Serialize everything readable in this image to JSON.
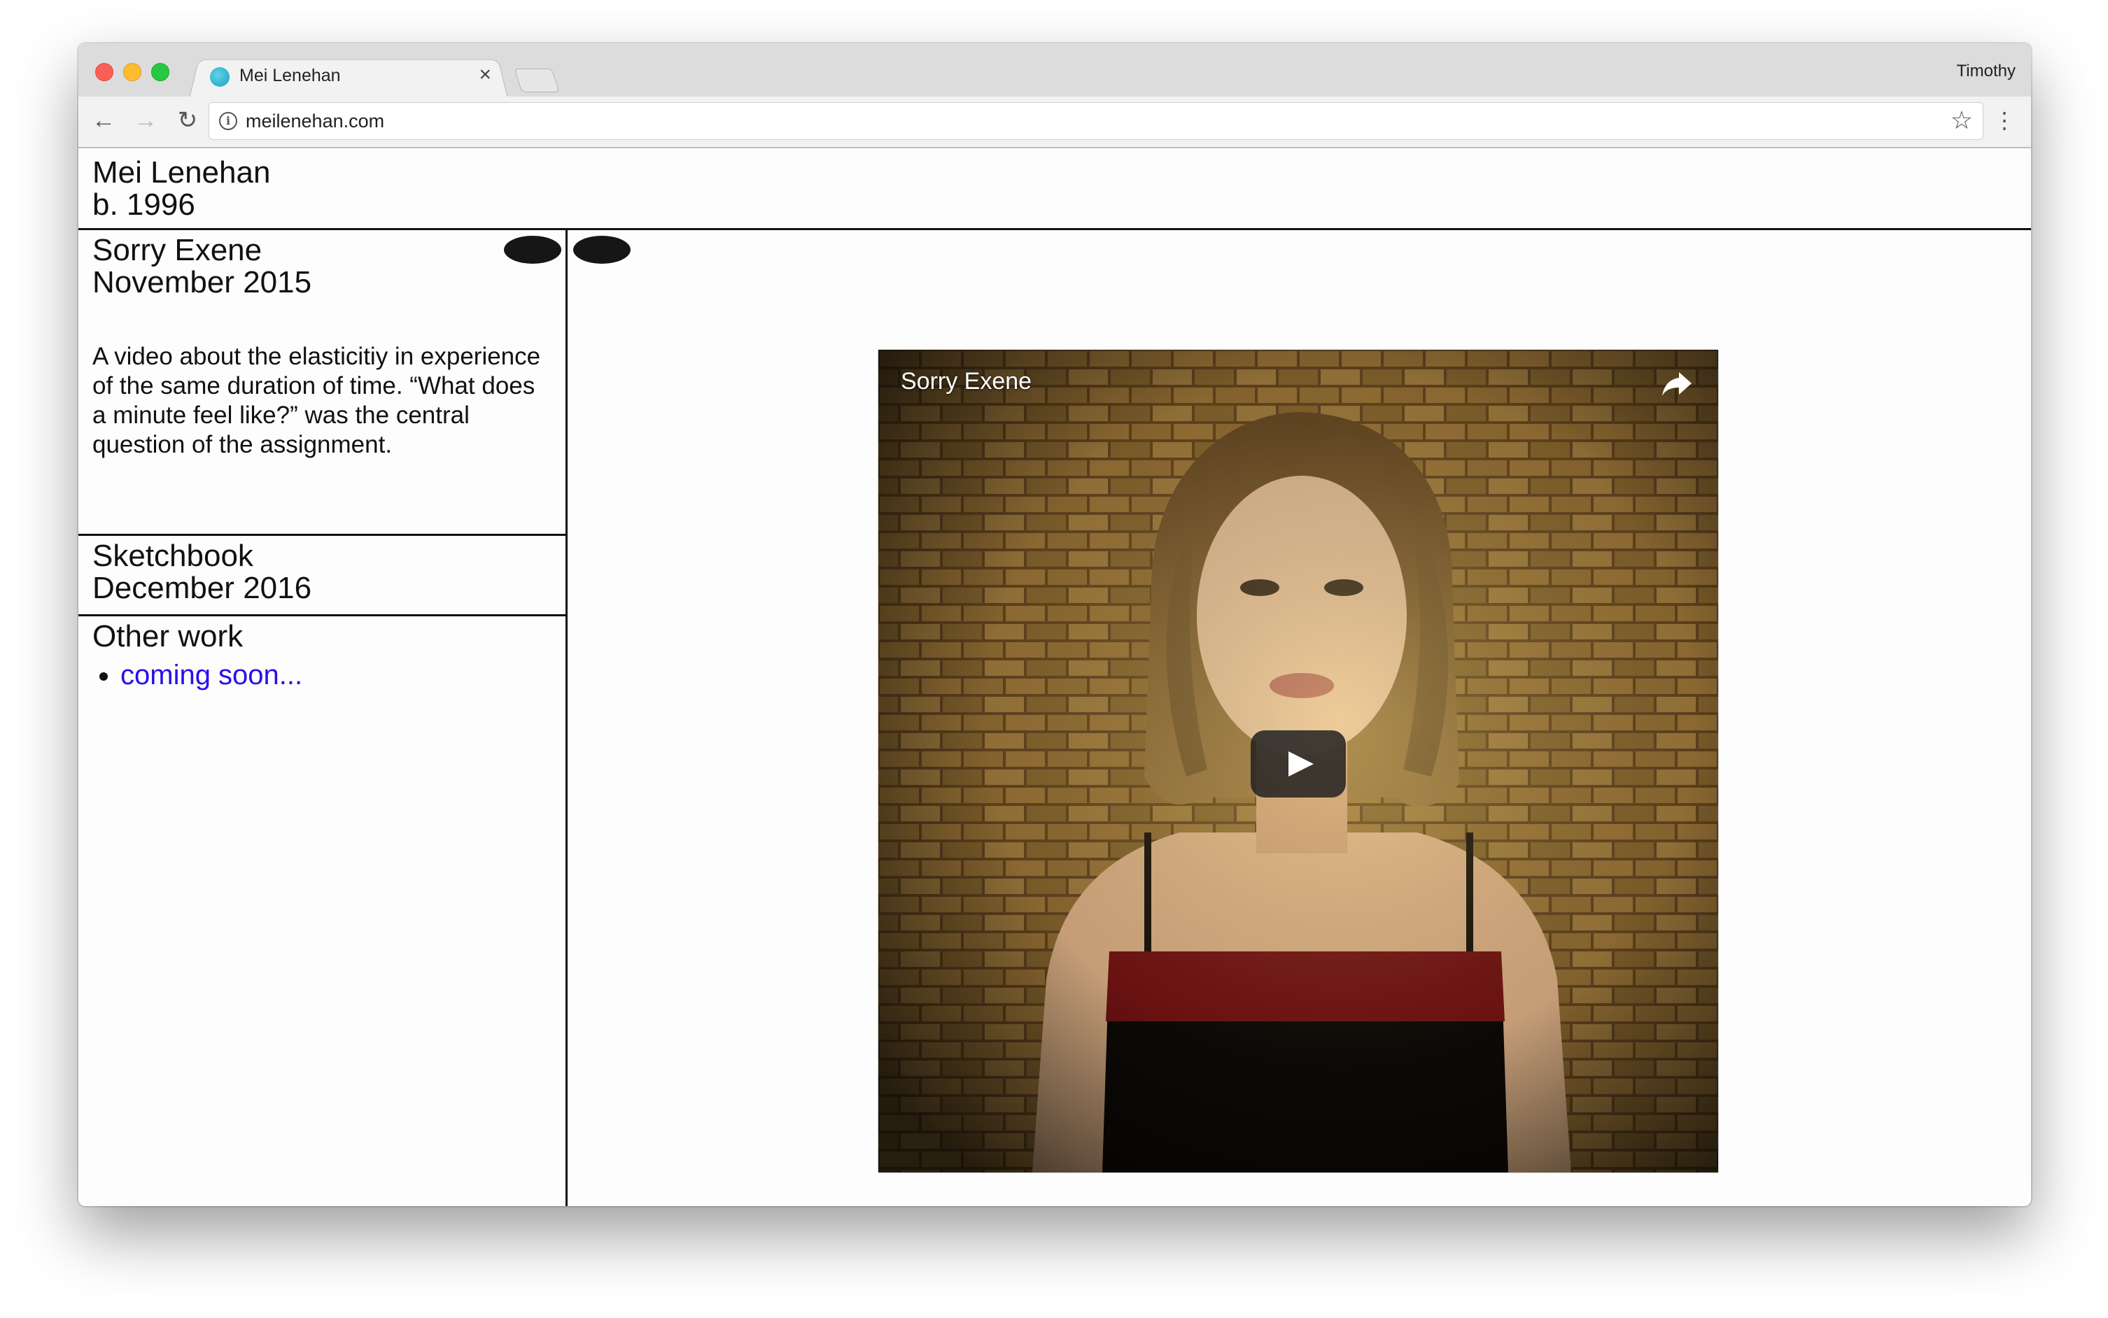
{
  "browser": {
    "tab_title": "Mei Lenehan",
    "tab_close_icon": "close-icon",
    "profile_name": "Timothy",
    "url": "meilenehan.com"
  },
  "site": {
    "name": "Mei Lenehan",
    "born": "b. 1996"
  },
  "projects": [
    {
      "title": "Sorry Exene",
      "date": "November 2015",
      "description": "A video about the elasticitiy in experience of the same duration of time. “What does a minute feel like?” was the central question of the assignment."
    },
    {
      "title": "Sketchbook",
      "date": "December 2016"
    }
  ],
  "other_work": {
    "heading": "Other work",
    "items": [
      "coming soon..."
    ],
    "link_color": "#2a0ee8"
  },
  "video": {
    "title": "Sorry Exene",
    "share_icon": "share-icon",
    "play_icon": "play-icon"
  },
  "colors": {
    "rule": "#111111",
    "dot": "#161616"
  }
}
